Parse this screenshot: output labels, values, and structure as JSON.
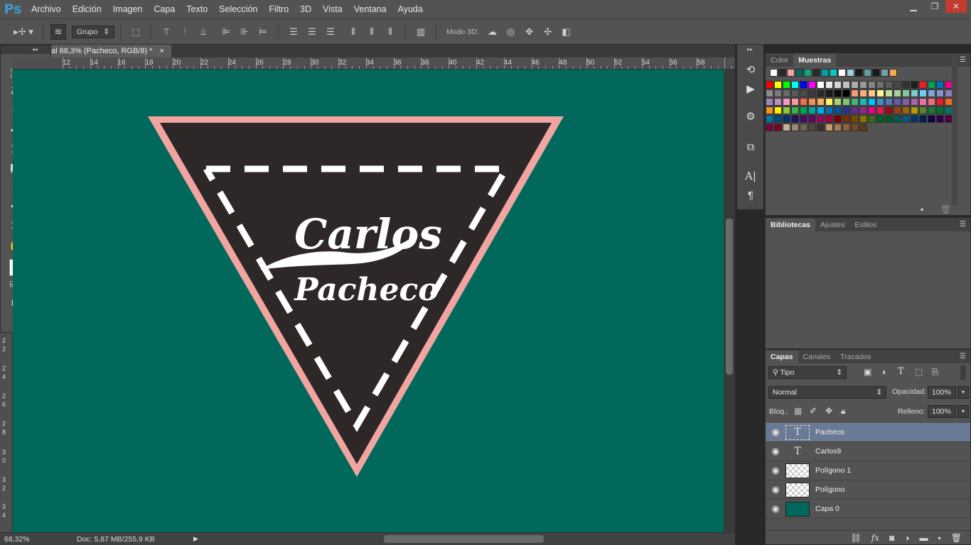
{
  "app": {
    "logo": "Ps"
  },
  "menu": [
    "Archivo",
    "Edición",
    "Imagen",
    "Capa",
    "Texto",
    "Selección",
    "Filtro",
    "3D",
    "Vista",
    "Ventana",
    "Ayuda"
  ],
  "window_controls": {
    "minimize": "▁",
    "restore": "❐",
    "close": "✕"
  },
  "options_bar": {
    "auto_select_value": "Grupo",
    "mode3d_label": "Modo 3D:"
  },
  "toolbox": {
    "collapse_label": "◂◂"
  },
  "document": {
    "tab_title": "al 68,3% (Pacheco, RGB/8) *",
    "tab_close": "×",
    "ruler_top_labels": [
      "12",
      "14",
      "16",
      "18",
      "20",
      "22",
      "24",
      "26",
      "28",
      "30",
      "32",
      "34",
      "36",
      "38",
      "40",
      "42",
      "44",
      "46",
      "48",
      "50",
      "52",
      "54",
      "56",
      "58"
    ],
    "ruler_left_labels": [
      "2",
      "2",
      "2",
      "4",
      "2",
      "6",
      "2",
      "8",
      "3",
      "0",
      "3",
      "2",
      "3",
      "4"
    ],
    "canvas_color": "#00695c",
    "artwork": {
      "outer_color": "#f2a5a0",
      "inner_color": "#2e2728",
      "dash_color": "#ffffff",
      "text_line1": "Carlos",
      "text_line2": "Pacheco"
    }
  },
  "status": {
    "zoom": "68,32%",
    "doc": "Doc: 5,87 MB/255,9 KB"
  },
  "panels": {
    "color_tabs": {
      "color": "Color",
      "muestras": "Muestras"
    },
    "library_tabs": {
      "bibliotecas": "Bibliotecas",
      "ajustes": "Ajustes",
      "estilos": "Estilos"
    },
    "layers_tabs": {
      "capas": "Capas",
      "canales": "Canales",
      "trazados": "Trazados"
    },
    "filter_kind": "Tipo",
    "blend_mode": "Normal",
    "opacity_label": "Opacidad:",
    "opacity_value": "100%",
    "lock_label": "Bloq.:",
    "fill_label": "Relleno:",
    "fill_value": "100%",
    "layers": [
      {
        "name": "Pacheco",
        "kind": "text",
        "selected": true
      },
      {
        "name": "Carlos9",
        "kind": "text",
        "selected": false
      },
      {
        "name": "Polígono 1",
        "kind": "shape",
        "selected": false
      },
      {
        "name": "Polígono",
        "kind": "shape",
        "selected": false
      },
      {
        "name": "Capa 0",
        "kind": "fill",
        "selected": false
      }
    ]
  },
  "swatches": {
    "recent": [
      "#ffffff",
      "#2e2728",
      "#f2a5a0",
      "#00695c",
      "#1aa37a",
      "#2a2a2a",
      "#00a0a0",
      "#00c8c8",
      "#ffffff",
      "#9fd0e0",
      "#1a1a1a",
      "#5f9ea0",
      "#1a1a1a",
      "#76a0a8",
      "#f7a94c"
    ],
    "rows": [
      [
        "#ff0000",
        "#ffff00",
        "#00ff00",
        "#00ffff",
        "#0000ff",
        "#ff00ff",
        "#ffffff",
        "#ebebeb",
        "#d6d6d6",
        "#c2c2c2",
        "#adadad",
        "#999999",
        "#858585",
        "#707070",
        "#5c5c5c",
        "#474747",
        "#333333",
        "#1f1f1f",
        "#ee1d24",
        "#00a650",
        "#0072bc",
        "#ec008c"
      ],
      [
        "#8c8c8c",
        "#7b7b7b",
        "#6a6a6a",
        "#5a5a5a",
        "#4a4a4a",
        "#3a3a3a",
        "#2a2a2a",
        "#1a1a1a",
        "#0a0a0a",
        "#000000",
        "#f7977a",
        "#f9ad81",
        "#fdc68a",
        "#fff79a",
        "#c4df9b",
        "#a2d39c",
        "#82ca9d",
        "#7bcdc8",
        "#6ecff6",
        "#7ea7d8",
        "#8493ca",
        "#8882be"
      ],
      [
        "#a187be",
        "#bc8dbf",
        "#f49ac2",
        "#f6989d",
        "#f26c4f",
        "#f68e55",
        "#fbaf5c",
        "#fff467",
        "#acd372",
        "#7cc576",
        "#3bb878",
        "#1abbb4",
        "#00bff3",
        "#438ccb",
        "#5574b9",
        "#605ca8",
        "#855fa8",
        "#a763a8",
        "#f06ea9",
        "#f26d7d",
        "#ed1c24",
        "#f26522"
      ],
      [
        "#f7941d",
        "#fff200",
        "#8dc73f",
        "#39b54a",
        "#00a651",
        "#00a99d",
        "#00aeef",
        "#0072bc",
        "#0054a6",
        "#2e3192",
        "#662d91",
        "#92278f",
        "#ec008c",
        "#ed145b",
        "#9e0b0f",
        "#a0410d",
        "#a36209",
        "#aba000",
        "#598527",
        "#1a7b30",
        "#007236",
        "#00746b"
      ],
      [
        "#0076a3",
        "#004b80",
        "#003471",
        "#1b1464",
        "#440e62",
        "#630460",
        "#9e005d",
        "#9e0039",
        "#790000",
        "#7b2e00",
        "#7d4900",
        "#827b00",
        "#406618",
        "#005e20",
        "#005826",
        "#005952",
        "#005b7f",
        "#003663",
        "#002157",
        "#0d004c",
        "#32004b",
        "#4b0049"
      ],
      [
        "#7b0046",
        "#7a0026",
        "#c7b299",
        "#998675",
        "#736357",
        "#534741",
        "#37302d",
        "#c69c6d",
        "#a67c52",
        "#8c6239",
        "#754c24",
        "#603913"
      ]
    ]
  }
}
